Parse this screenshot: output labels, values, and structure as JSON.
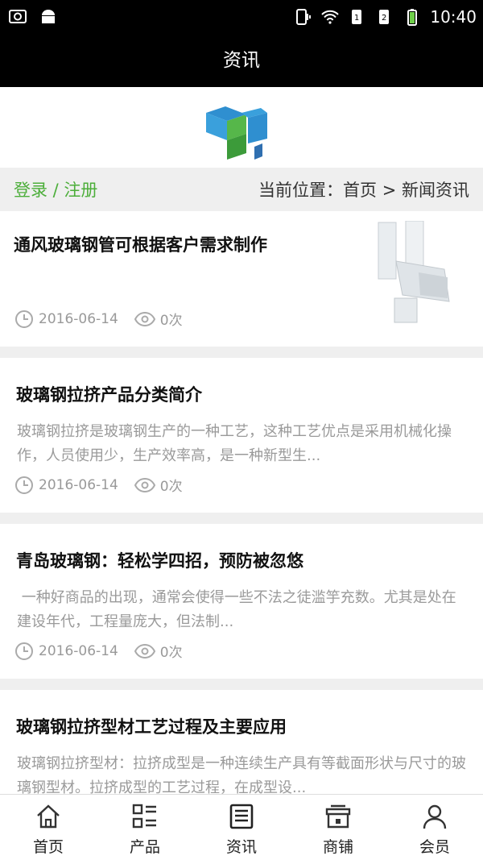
{
  "status_bar": {
    "time": "10:40"
  },
  "app_bar": {
    "title": "资讯"
  },
  "location_bar": {
    "login_label": "登录 / 注册",
    "breadcrumb": "当前位置：首页 > 新闻资讯"
  },
  "articles": [
    {
      "title": "通风玻璃钢管可根据客户需求制作",
      "date": "2016-06-14",
      "views": "0次"
    },
    {
      "title": "玻璃钢拉挤产品分类简介",
      "summary": "玻璃钢拉挤是玻璃钢生产的一种工艺，这种工艺优点是采用机械化操作，人员使用少，生产效率高，是一种新型生...",
      "date": "2016-06-14",
      "views": "0次"
    },
    {
      "title": "青岛玻璃钢：轻松学四招，预防被忽悠",
      "summary": " 一种好商品的出现，通常会使得一些不法之徒滥竽充数。尤其是处在建设年代，工程量庞大，但法制...",
      "date": "2016-06-14",
      "views": "0次"
    },
    {
      "title": "玻璃钢拉挤型材工艺过程及主要应用",
      "summary": "玻璃钢拉挤型材：拉挤成型是一种连续生产具有等截面形状与尺寸的玻璃钢型材。拉挤成型的工艺过程，在成型设..."
    }
  ],
  "tab_bar": {
    "tabs": [
      {
        "label": "首页",
        "icon": "home-icon"
      },
      {
        "label": "产品",
        "icon": "list-icon"
      },
      {
        "label": "资讯",
        "icon": "news-icon"
      },
      {
        "label": "商铺",
        "icon": "shop-icon"
      },
      {
        "label": "会员",
        "icon": "user-icon"
      }
    ]
  },
  "colors": {
    "accent": "#4cae3a",
    "bar": "#000000",
    "background": "#efefef"
  }
}
